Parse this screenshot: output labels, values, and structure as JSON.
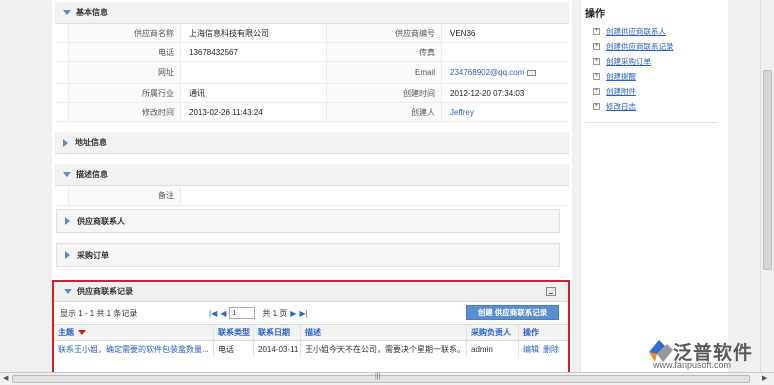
{
  "basic_info": {
    "title": "基本信息",
    "rows": [
      {
        "l1": "供应商名称",
        "v1": "上海信息科技有限公司",
        "l2": "供应商编号",
        "v2": "VEN36"
      },
      {
        "l1": "电话",
        "v1": "13678432567",
        "l2": "传真",
        "v2": ""
      },
      {
        "l1": "网址",
        "v1": "",
        "l2": "Email",
        "v2": "234768902@qq.com"
      },
      {
        "l1": "所属行业",
        "v1": "通讯",
        "l2": "创建时间",
        "v2": "2012-12-20 07:34:03"
      },
      {
        "l1": "修改时间",
        "v1": "2013-02-28 11:43:24",
        "l2": "创建人",
        "v2": "Jeffrey"
      }
    ]
  },
  "address_info": {
    "title": "地址信息"
  },
  "desc_info": {
    "title": "描述信息",
    "remark_label": "备注",
    "remark_value": ""
  },
  "contacts": {
    "title": "供应商联系人"
  },
  "orders": {
    "title": "采购订单"
  },
  "records": {
    "title": "供应商联系记录",
    "summary": "显示 1 - 1 共 1 条记录",
    "page_value": "1",
    "total_pages": "共 1 页",
    "create_button": "创建 供应商联系记录",
    "columns": [
      "主题",
      "联系类型",
      "联系日期",
      "描述",
      "采购负责人",
      "操作"
    ],
    "rows": [
      {
        "subject": "联系王小姐，确定需要的软件包装盒数量...",
        "type": "电话",
        "date": "2014-03-11",
        "desc": "王小姐今天不在公司，需要决个星期一联系。",
        "owner": "admin",
        "edit": "编辑",
        "delete": "删除"
      }
    ]
  },
  "sidebar": {
    "title": "操作",
    "items": [
      "创建供应商联系人",
      "创建供应商联系记录",
      "创建采购订单",
      "创建提醒",
      "创建附件",
      "修改日志"
    ]
  },
  "logo": {
    "name": "泛普软件",
    "url": "www.fanpusoft.com"
  },
  "colors": {
    "link": "#2a62c8",
    "highlight_border": "#d31f25",
    "button": "#5b8ed0"
  }
}
